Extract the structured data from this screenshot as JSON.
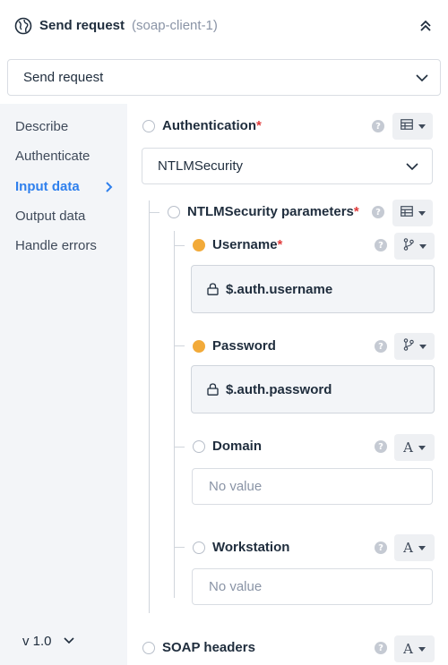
{
  "header": {
    "title": "Send request",
    "subtitle": "(soap-client-1)",
    "icon": "globe-icon",
    "collapse_icon": "double-chevron-up-icon"
  },
  "operation": {
    "value": "Send request"
  },
  "sidebar": {
    "items": [
      {
        "label": "Describe"
      },
      {
        "label": "Authenticate"
      },
      {
        "label": "Input data"
      },
      {
        "label": "Output data"
      },
      {
        "label": "Handle errors"
      }
    ],
    "active_index": 2,
    "version": "v 1.0"
  },
  "fields": {
    "authentication": {
      "label": "Authentication",
      "required": "*",
      "value": "NTLMSecurity",
      "type_icon": "table-icon"
    },
    "ntlm_params": {
      "label": "NTLMSecurity parameters",
      "required": "*",
      "type_icon": "table-icon"
    },
    "username": {
      "label": "Username",
      "required": "*",
      "value": "$.auth.username",
      "type_icon": "branch-icon"
    },
    "password": {
      "label": "Password",
      "value": "$.auth.password",
      "type_icon": "branch-icon"
    },
    "domain": {
      "label": "Domain",
      "placeholder": "No value",
      "type_icon": "A"
    },
    "workstation": {
      "label": "Workstation",
      "placeholder": "No value",
      "type_icon": "A"
    },
    "soap_headers": {
      "label": "SOAP headers",
      "type_icon": "A"
    }
  },
  "colors": {
    "accent": "#2f80ed",
    "required": "#e03a3a",
    "mapped_dot": "#f2aa39",
    "sidebar_bg": "#f3f5f8"
  }
}
